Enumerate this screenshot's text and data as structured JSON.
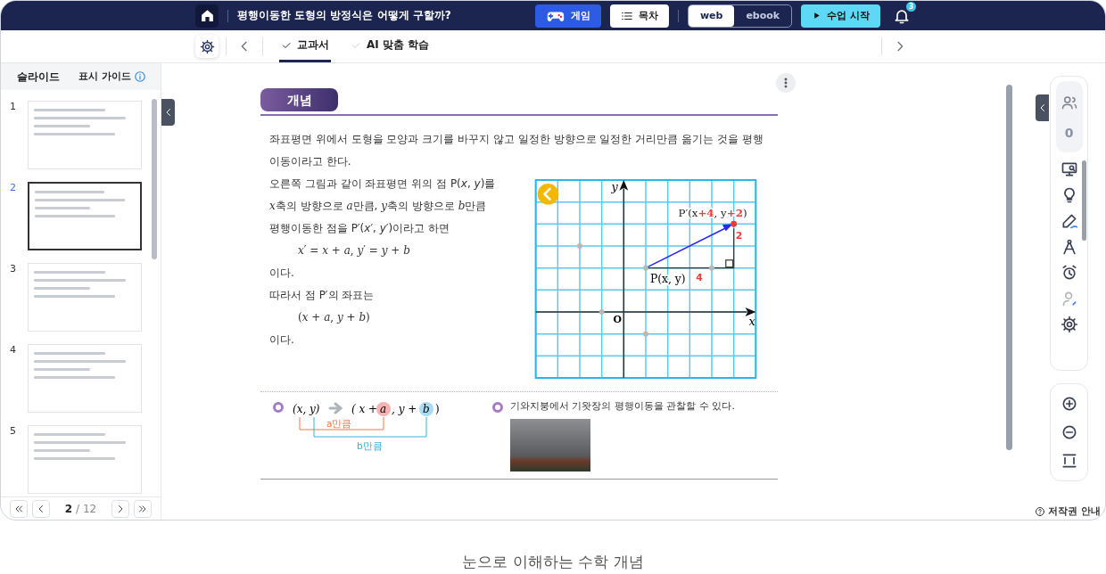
{
  "header": {
    "title": "평행이동한 도형의 방정식은 어떻게 구할까?",
    "game_button": "게임",
    "toc_button": "목차",
    "view_modes": [
      {
        "label": "web",
        "selected": true
      },
      {
        "label": "ebook",
        "selected": false
      }
    ],
    "start_button": "수업 시작",
    "notification_count": "3"
  },
  "tabs": [
    {
      "label": "교과서",
      "selected": true
    },
    {
      "label": "AI 맞춤 학습",
      "selected": false
    }
  ],
  "sidebar": {
    "title": "슬라이드",
    "guide": "표시 가이드",
    "slides": [
      {
        "number": "1",
        "selected": false
      },
      {
        "number": "2",
        "selected": true
      },
      {
        "number": "3",
        "selected": false
      },
      {
        "number": "4",
        "selected": false
      },
      {
        "number": "5",
        "selected": false
      }
    ],
    "pager": {
      "current": "2",
      "separator": "/",
      "total": "12"
    }
  },
  "concept": {
    "badge": "개념",
    "intro": "좌표평면 위에서 도형을 모양과 크기를 바꾸지 않고 일정한 방향으로 일정한 거리만큼 옮기는 것을 평행이동이라고 한다.",
    "lines": [
      {
        "kind": "text",
        "text": "오른쪽 그림과 같이 좌표평면 위의 점 P(*x*, *y*)를"
      },
      {
        "kind": "mixed",
        "parts": [
          {
            "kind": "math",
            "text": "x"
          },
          {
            "kind": "plain",
            "text": "축의 방향으로 "
          },
          {
            "kind": "math",
            "text": "a"
          },
          {
            "kind": "plain",
            "text": "만큼, "
          },
          {
            "kind": "math",
            "text": "y"
          },
          {
            "kind": "plain",
            "text": "축의 방향으로 "
          },
          {
            "kind": "math",
            "text": "b"
          },
          {
            "kind": "plain",
            "text": "만큼"
          }
        ]
      },
      {
        "kind": "text",
        "text": "평행이동한 점을 P′(*x*′, *y*′)이라고 하면"
      },
      {
        "kind": "formula",
        "text": "*x*′ = *x* + *a*, *y*′ = *y* + *b*"
      },
      {
        "kind": "text",
        "text": "이다."
      },
      {
        "kind": "text",
        "text": "따라서 점 P′의 좌표는"
      },
      {
        "kind": "formula",
        "text": "(*x* + *a*, *y* + *b*)"
      },
      {
        "kind": "text",
        "text": "이다."
      }
    ],
    "graph": {
      "x_axis": "x",
      "y_axis": "y",
      "origin": "O",
      "p_label": "P(x, y)",
      "p_prime_label": [
        {
          "text": "P′(x",
          "highlight": false
        },
        {
          "text": "+4",
          "highlight": true
        },
        {
          "text": ", y",
          "highlight": false
        },
        {
          "text": "+2",
          "highlight": true
        },
        {
          "text": ")",
          "highlight": false
        }
      ],
      "dx_label": "4",
      "dy_label": "2"
    },
    "mapping": {
      "from": "(x, y)",
      "to_start": "( x +",
      "a": "a",
      "to_mid": ", y +",
      "b": "b",
      "to_end": ")",
      "a_label": "a만큼",
      "b_label": "b만큼"
    },
    "observation": "기와지붕에서 기왓장의 평행이동을 관찰할 수 있다."
  },
  "toolbar": {
    "participant_count": "0"
  },
  "copyright": "저작권 안내",
  "caption": "눈으로 이해하는 수학 개념"
}
